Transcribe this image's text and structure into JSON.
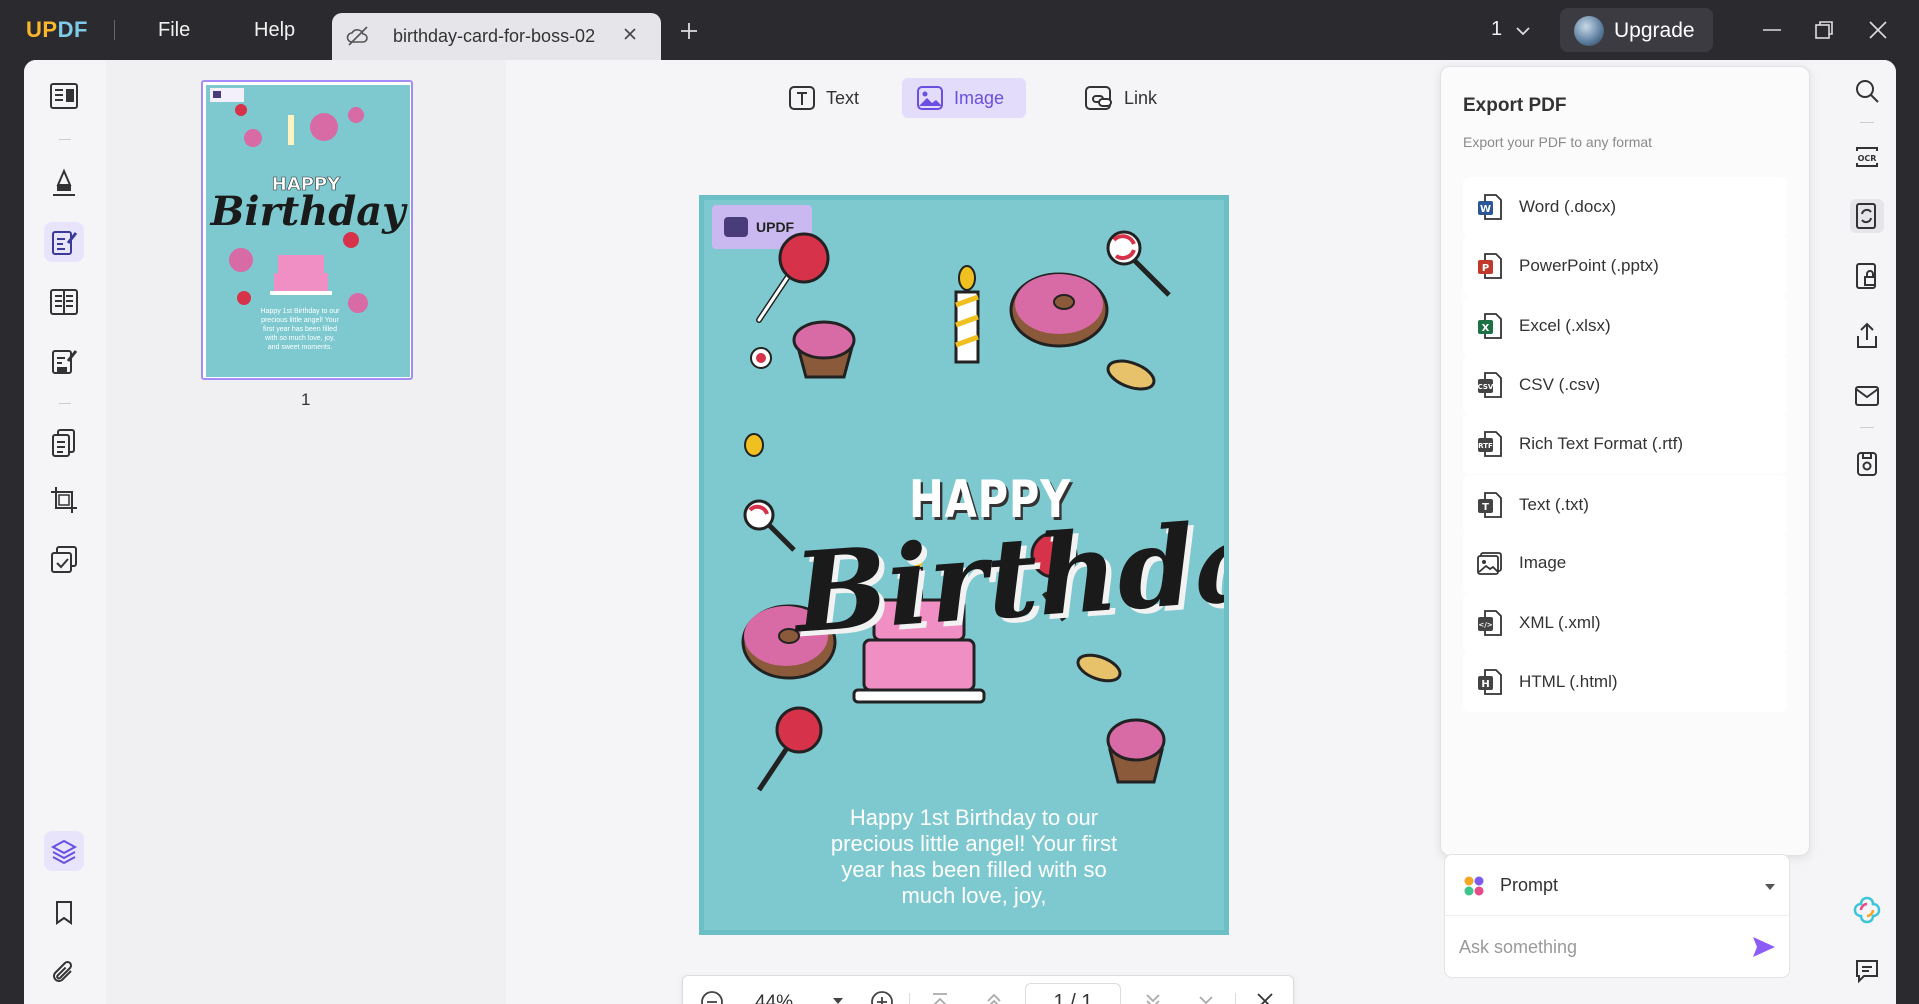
{
  "app": {
    "logo_part1": "UP",
    "logo_part2": "DF"
  },
  "menu": {
    "file": "File",
    "help": "Help"
  },
  "tab": {
    "title": "birthday-card-for-boss-02"
  },
  "titlebar": {
    "window_count": "1",
    "upgrade_label": "Upgrade"
  },
  "thumbnails": {
    "page_number": "1"
  },
  "edit_toolbar": {
    "text": "Text",
    "image": "Image",
    "link": "Link",
    "active": "Image"
  },
  "card": {
    "logo_text": "UPDF",
    "happy": "HAPPY",
    "birthday": "Birthday",
    "message": "Happy 1st Birthday to our precious little angel! Your first year has been filled with so much love, joy,"
  },
  "zoom": {
    "value": "44%",
    "page_display": "1 / 1"
  },
  "export_panel": {
    "title": "Export PDF",
    "subtitle": "Export your PDF to any format",
    "formats": [
      {
        "label": "Word (.docx)",
        "icon": "word-icon",
        "color": "#2b5797",
        "letter": "W"
      },
      {
        "label": "PowerPoint (.pptx)",
        "icon": "powerpoint-icon",
        "color": "#c0392b",
        "letter": "P"
      },
      {
        "label": "Excel (.xlsx)",
        "icon": "excel-icon",
        "color": "#1e7145",
        "letter": "X"
      },
      {
        "label": "CSV (.csv)",
        "icon": "csv-icon",
        "color": "#444444",
        "letter": "CSV"
      },
      {
        "label": "Rich Text Format (.rtf)",
        "icon": "rtf-icon",
        "color": "#444444",
        "letter": "RTF"
      },
      {
        "label": "Text (.txt)",
        "icon": "text-file-icon",
        "color": "#444444",
        "letter": "T"
      },
      {
        "label": "Image",
        "icon": "image-icon",
        "color": "#444444",
        "letter": ""
      },
      {
        "label": "XML (.xml)",
        "icon": "xml-icon",
        "color": "#444444",
        "letter": "</>"
      },
      {
        "label": "HTML (.html)",
        "icon": "html-icon",
        "color": "#444444",
        "letter": "H"
      }
    ]
  },
  "ai": {
    "prompt_label": "Prompt",
    "ask_placeholder": "Ask something"
  },
  "colors": {
    "accent": "#7a5cf0",
    "card_bg": "#7ec9d0",
    "titlebar": "#2b2b2f",
    "send": "#8b5cf6"
  }
}
